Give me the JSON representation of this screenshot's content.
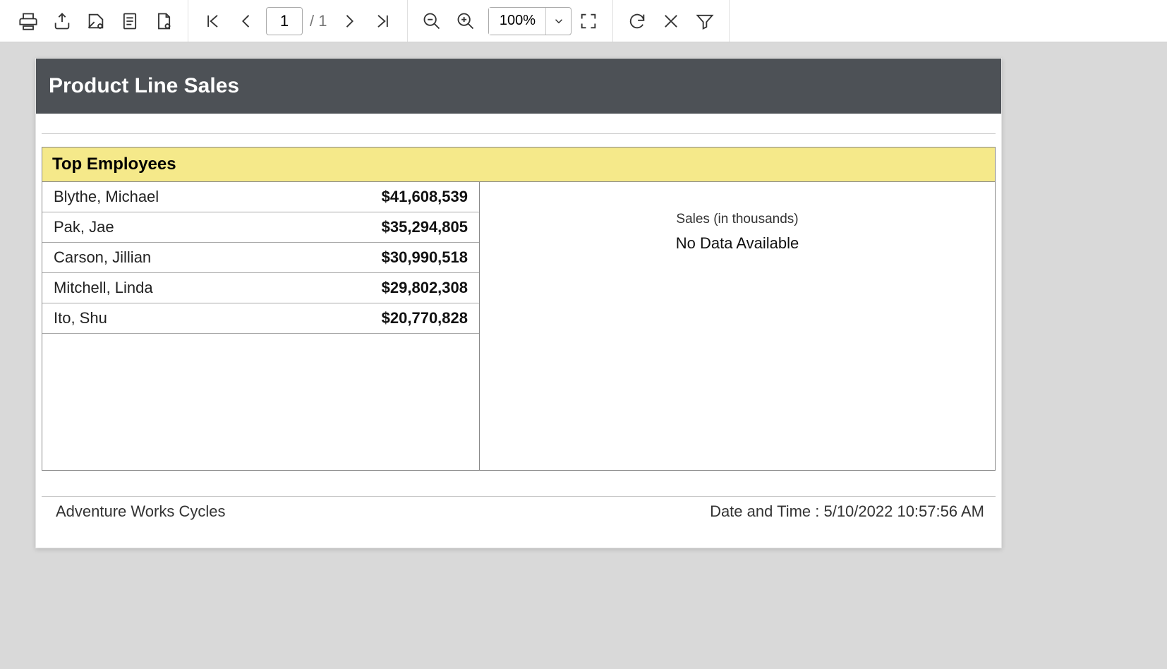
{
  "toolbar": {
    "page_current": "1",
    "page_total": "/ 1",
    "zoom_value": "100%"
  },
  "report": {
    "title": "Product Line Sales",
    "section_header": "Top Employees",
    "rows": [
      {
        "name": "Blythe, Michael",
        "value": "$41,608,539"
      },
      {
        "name": "Pak, Jae",
        "value": "$35,294,805"
      },
      {
        "name": "Carson, Jillian",
        "value": "$30,990,518"
      },
      {
        "name": "Mitchell, Linda",
        "value": "$29,802,308"
      },
      {
        "name": "Ito, Shu",
        "value": "$20,770,828"
      }
    ],
    "chart_title": "Sales (in thousands)",
    "chart_message": "No Data Available",
    "footer_left": "Adventure Works Cycles",
    "footer_right": "Date and Time : 5/10/2022 10:57:56 AM"
  }
}
